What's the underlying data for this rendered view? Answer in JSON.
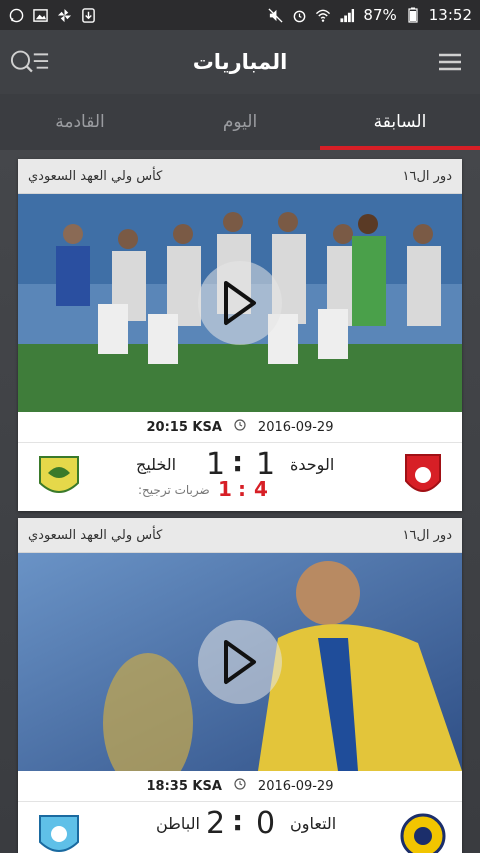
{
  "status_bar": {
    "battery": "87%",
    "time": "13:52"
  },
  "header": {
    "title": "المباريات"
  },
  "tabs": [
    {
      "label": "السابقة",
      "active": true
    },
    {
      "label": "اليوم",
      "active": false
    },
    {
      "label": "القادمة",
      "active": false
    }
  ],
  "matches": [
    {
      "round": "دور ال١٦",
      "competition": "كأس ولي العهد السعودي",
      "date": "2016-09-29",
      "time": "20:15 KSA",
      "home_team": "الوحدة",
      "home_score": "1",
      "away_team": "الخليج",
      "away_score": "1",
      "penalties_label": ":ضربات ترجيح",
      "home_pens": "4",
      "away_pens": "1"
    },
    {
      "round": "دور ال١٦",
      "competition": "كأس ولي العهد السعودي",
      "date": "2016-09-29",
      "time": "18:35 KSA",
      "home_team": "التعاون",
      "home_score": "0",
      "away_team": "الباطن",
      "away_score": "2"
    }
  ],
  "colors": {
    "accent": "#d71f26",
    "appbar": "#3f4145"
  }
}
